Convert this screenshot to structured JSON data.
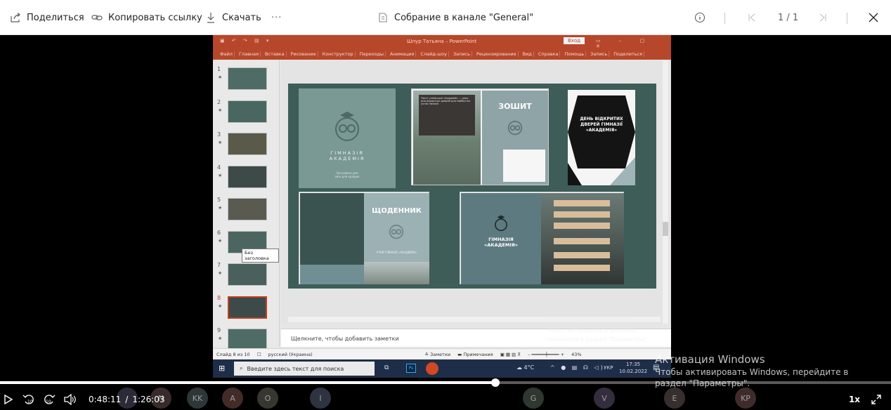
{
  "toolbar": {
    "share_label": "Поделиться",
    "copy_link_label": "Копировать ссылку",
    "download_label": "Скачать",
    "more_label": "···",
    "document_title": "Собрание в канале \"General\"",
    "page_counter": "1 / 1"
  },
  "powerpoint": {
    "window_title": "Шпур Татьяна – PowerPoint",
    "login_label": "Вход",
    "ribbon_tabs": [
      "Файл",
      "Главная",
      "Вставка",
      "Рисование",
      "Конструктор",
      "Переходы",
      "Анимация",
      "Слайд-шоу",
      "Запись",
      "Рецензирование",
      "Вид",
      "Справка",
      "Помощь",
      "Запись",
      "Поделиться"
    ],
    "slides": [
      {
        "num": "1"
      },
      {
        "num": "2"
      },
      {
        "num": "3"
      },
      {
        "num": "4"
      },
      {
        "num": "5"
      },
      {
        "num": "6"
      },
      {
        "num": "7"
      },
      {
        "num": "8",
        "active": true
      },
      {
        "num": "9"
      }
    ],
    "tooltip": "Без заголовка",
    "notes_placeholder": "Щелкните, чтобы добавить заметки",
    "status": {
      "slide_of": "Слайд 8 из 10",
      "language": "русский (Украина)",
      "notes_btn": "Заметки",
      "comments_btn": "Примечания",
      "zoom": "43%"
    },
    "slide_content": {
      "card1_title": "ГІМНАЗІЯ\nАКАДЕМІЯ",
      "card1_sub": "Заснована для\nзмін для кращих",
      "card2_text": "Текст учнівської «Академії» — опис дня відкритих дверей для майбутніх учнів гімназії",
      "card2_title": "ЗОШИТ",
      "card3_title": "ДЕНЬ ВІДКРИТИХ ДВЕРЕЙ ГІМНАЗІЇ «АКАДЕМІЯ»",
      "card4_title": "ЩОДЕННИК",
      "card4_sub": "УЧНЯ ГІМНАЗІЇ «АКАДЕМІЯ»",
      "card5_title": "ГІМНАЗІЯ\n«АКАДЕМІЯ»"
    }
  },
  "taskbar": {
    "search_placeholder": "Введите здесь текст для поиска",
    "weather": "4°C",
    "lang": "УКР",
    "time": "17:35",
    "date": "10.02.2022"
  },
  "activation": {
    "title": "Активация Windows",
    "line1": "Чтобы активировать Windows, перейдите в",
    "line2": "раздел \"Параметры\".",
    "small_line1": "Чтобы активировать Windows,",
    "small_line2": "перейдите в раздел \"Параметры\"."
  },
  "participants": [
    {
      "initials": ""
    },
    {
      "initials": "N"
    },
    {
      "initials": "KK"
    },
    {
      "initials": "A"
    },
    {
      "initials": "O"
    },
    {
      "initials": "I"
    },
    {
      "initials": "G"
    },
    {
      "initials": "V"
    },
    {
      "initials": "E"
    },
    {
      "initials": "KP"
    }
  ],
  "player": {
    "current_time": "0:48:11",
    "separator": "/",
    "duration": "1:26:03",
    "speed": "1x",
    "skip_back_label": "10",
    "skip_forward_label": "10",
    "progress_fraction": 0.556
  },
  "colors": {
    "ppt_accent": "#b7472a",
    "slide_bg": "#3e5d58",
    "taskbar": "#1f2e48"
  }
}
